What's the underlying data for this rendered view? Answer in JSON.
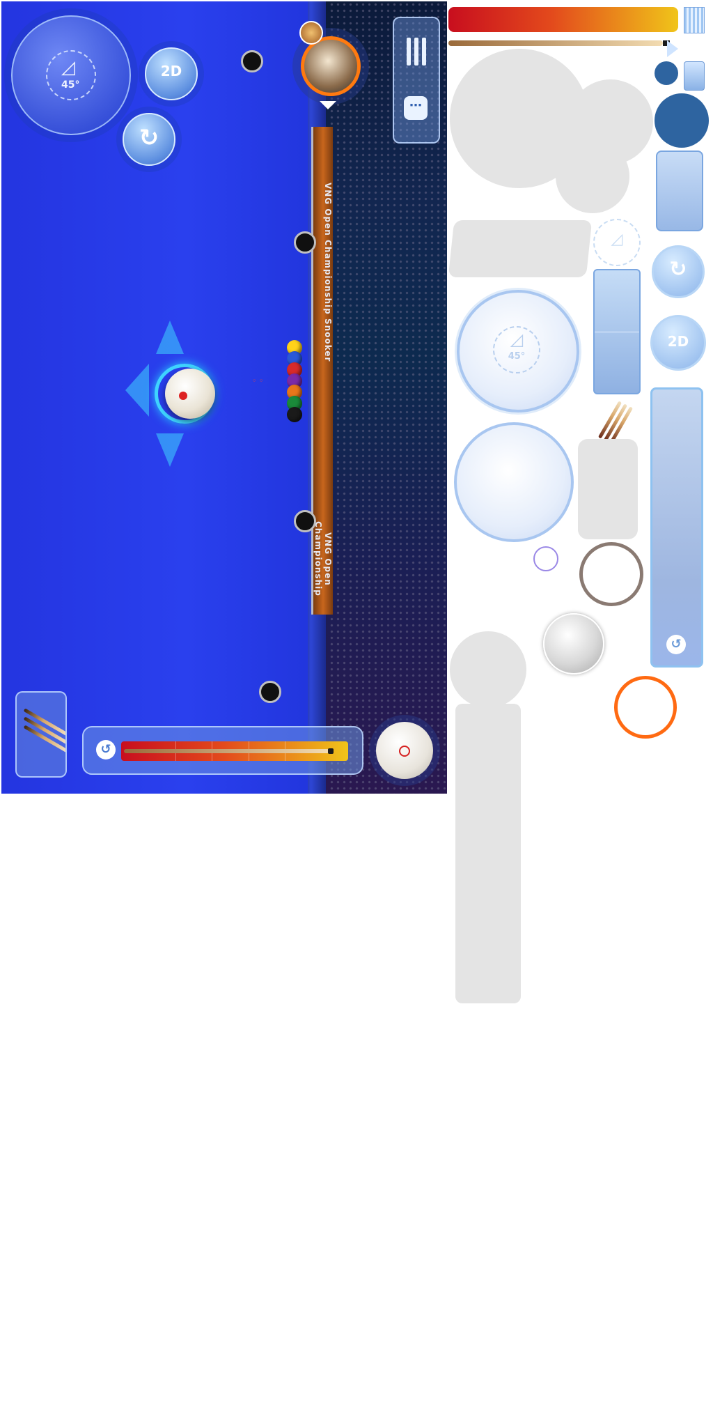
{
  "table": {
    "banner_text_top": "VNG Open Championship Snooker",
    "banner_text_bottom": "VNG Open Championship"
  },
  "hud": {
    "angle_label": "45°",
    "view_toggle_label": "2D",
    "spin_add_icon": "spin-plus-icon",
    "menu_icon": "menu-icon",
    "chat_icon": "chat-icon",
    "cue_select_icon": "cue-sticks-icon",
    "power_level": 0.95,
    "spin_icon": "spin-icon"
  },
  "atlas": {
    "angle_label": "45°",
    "view_toggle_label": "2D"
  },
  "colors": {
    "cloth": "#2a40ee",
    "accent_cyan": "#3fd4ff",
    "power_start": "#c80e1e",
    "power_end": "#f0c41a",
    "avatar_ring": "#ff7a10"
  }
}
